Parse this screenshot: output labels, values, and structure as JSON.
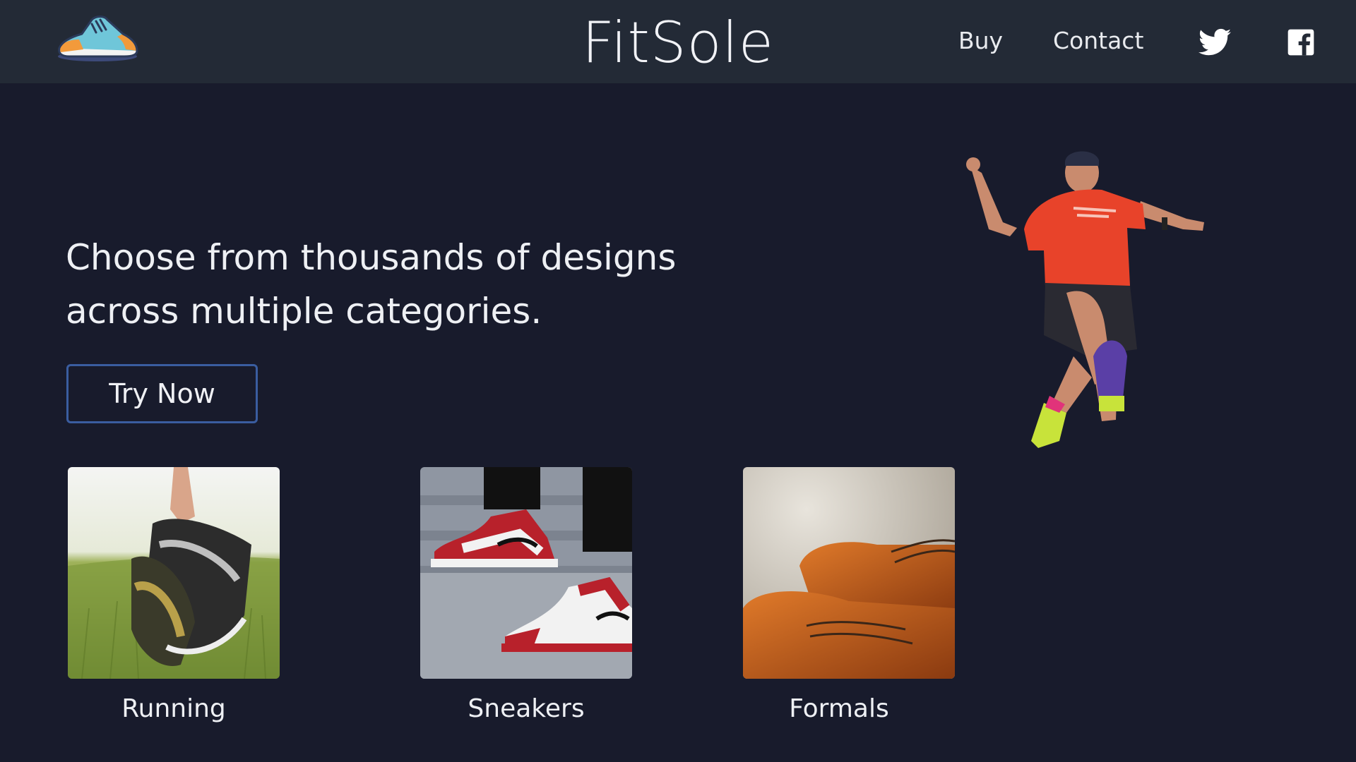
{
  "header": {
    "logo_icon": "sneaker-logo-icon",
    "brand": "FitSole",
    "nav": {
      "buy": "Buy",
      "contact": "Contact"
    },
    "social": {
      "twitter_icon": "twitter-icon",
      "facebook_icon": "facebook-icon"
    }
  },
  "hero": {
    "tagline": "Choose from thousands of designs across multiple categories.",
    "cta": "Try Now",
    "image_icon": "jumping-runner-image"
  },
  "categories": [
    {
      "label": "Running",
      "image": "running-shoes-image"
    },
    {
      "label": "Sneakers",
      "image": "sneakers-image"
    },
    {
      "label": "Formals",
      "image": "formal-shoes-image"
    }
  ],
  "colors": {
    "background": "#181b2c",
    "header": "#232a36",
    "button_border": "#3a5da0",
    "text": "#eef0f4"
  }
}
